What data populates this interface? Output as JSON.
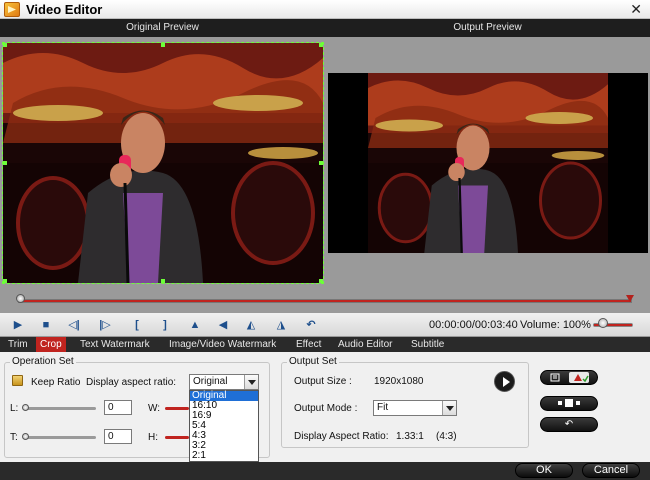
{
  "window": {
    "title": "Video Editor",
    "close_glyph": "✕"
  },
  "preview": {
    "original_label": "Original Preview",
    "output_label": "Output Preview"
  },
  "timeline": {
    "progress": 0.0
  },
  "controls": {
    "buttons": [
      {
        "name": "play-button",
        "icon": "play-icon",
        "glyph": "▶"
      },
      {
        "name": "stop-button",
        "icon": "stop-icon",
        "glyph": "■"
      },
      {
        "name": "prev-frame-button",
        "icon": "prev-frame-icon",
        "glyph": "◁|"
      },
      {
        "name": "next-frame-button",
        "icon": "next-frame-icon",
        "glyph": "|▷"
      },
      {
        "name": "mark-in-button",
        "icon": "mark-in-icon",
        "glyph": "["
      },
      {
        "name": "mark-out-button",
        "icon": "mark-out-icon",
        "glyph": "]"
      },
      {
        "name": "flip-vertical-button",
        "icon": "flip-vertical-icon",
        "glyph": "▲"
      },
      {
        "name": "flip-horizontal-button",
        "icon": "flip-horizontal-icon",
        "glyph": "◀"
      },
      {
        "name": "rotate-left-button",
        "icon": "rotate-left-icon",
        "glyph": "◭"
      },
      {
        "name": "rotate-right-button",
        "icon": "rotate-right-icon",
        "glyph": "◮"
      },
      {
        "name": "undo-button",
        "icon": "undo-icon",
        "glyph": "↶"
      }
    ],
    "time": "00:00:00/00:03:40",
    "volume_label": "Volume:",
    "volume_value": "100%",
    "volume_level": 1.0
  },
  "tabs": [
    {
      "label": "Trim",
      "active": false
    },
    {
      "label": "Crop",
      "active": true
    },
    {
      "label": "Text Watermark",
      "active": false
    },
    {
      "label": "Image/Video Watermark",
      "active": false
    },
    {
      "label": "Effect",
      "active": false
    },
    {
      "label": "Audio Editor",
      "active": false
    },
    {
      "label": "Subtitle",
      "active": false
    }
  ],
  "operation_set": {
    "title": "Operation Set",
    "keep_ratio_label": "Keep Ratio",
    "aspect_label": "Display aspect ratio:",
    "aspect_value": "Original",
    "l_label": "L:",
    "l_value": "0",
    "t_label": "T:",
    "t_value": "0",
    "w_label": "W:",
    "h_label": "H:"
  },
  "aspect_dropdown": {
    "options": [
      "Original",
      "16:10",
      "16:9",
      "5:4",
      "4:3",
      "3:2",
      "2:1"
    ],
    "selected": "Original"
  },
  "output_set": {
    "title": "Output Set",
    "size_label": "Output Size :",
    "size_value": "1920x1080",
    "mode_label": "Output Mode :",
    "mode_value": "Fit",
    "display_ratio_label": "Display Aspect Ratio:",
    "display_ratio_value": "1.33:1",
    "display_ratio_paren": "(4:3)"
  },
  "footer": {
    "ok_label": "OK",
    "cancel_label": "Cancel"
  },
  "colors": {
    "accent": "#c0241f",
    "dark": "#2a2a2a",
    "preview_bg": "#9a9a9a",
    "selection": "#1f6fd6"
  }
}
